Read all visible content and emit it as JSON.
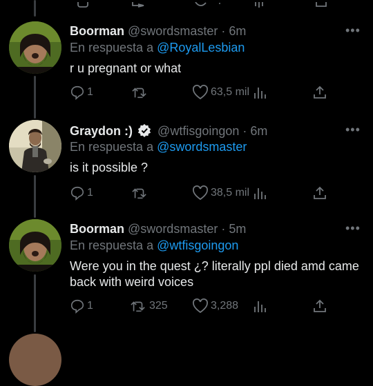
{
  "tweets": [
    {
      "name": "Boorman",
      "handle": "@swordsmaster",
      "dot": "·",
      "time": "6m",
      "reply_prefix": "En respuesta a",
      "reply_to": "@RoyalLesbian",
      "text": "r u pregnant or what",
      "replies": "1",
      "retweets": "",
      "likes": "63,5 mil",
      "verified": false
    },
    {
      "name": "Graydon :)",
      "handle": "@wtfisgoingon",
      "dot": "·",
      "time": "6m",
      "reply_prefix": "En respuesta a",
      "reply_to": "@swordsmaster",
      "text": "is it possible ?",
      "replies": "1",
      "retweets": "",
      "likes": "38,5 mil",
      "verified": true
    },
    {
      "name": "Boorman",
      "handle": "@swordsmaster",
      "dot": "·",
      "time": "5m",
      "reply_prefix": "En respuesta a",
      "reply_to": "@wtfisgoingon",
      "text": "Were you in the quest ¿? literally ppl died amd came back with weird voices",
      "replies": "1",
      "retweets": "325",
      "likes": "3,288",
      "verified": false
    }
  ],
  "more_label": "•••",
  "colors": {
    "accent": "#1d9bf0",
    "muted": "#71767b",
    "text": "#e7e9ea",
    "background": "#000000"
  },
  "icons": [
    "reply-icon",
    "retweet-icon",
    "like-icon",
    "views-icon",
    "share-icon",
    "more-icon",
    "verified-icon"
  ]
}
